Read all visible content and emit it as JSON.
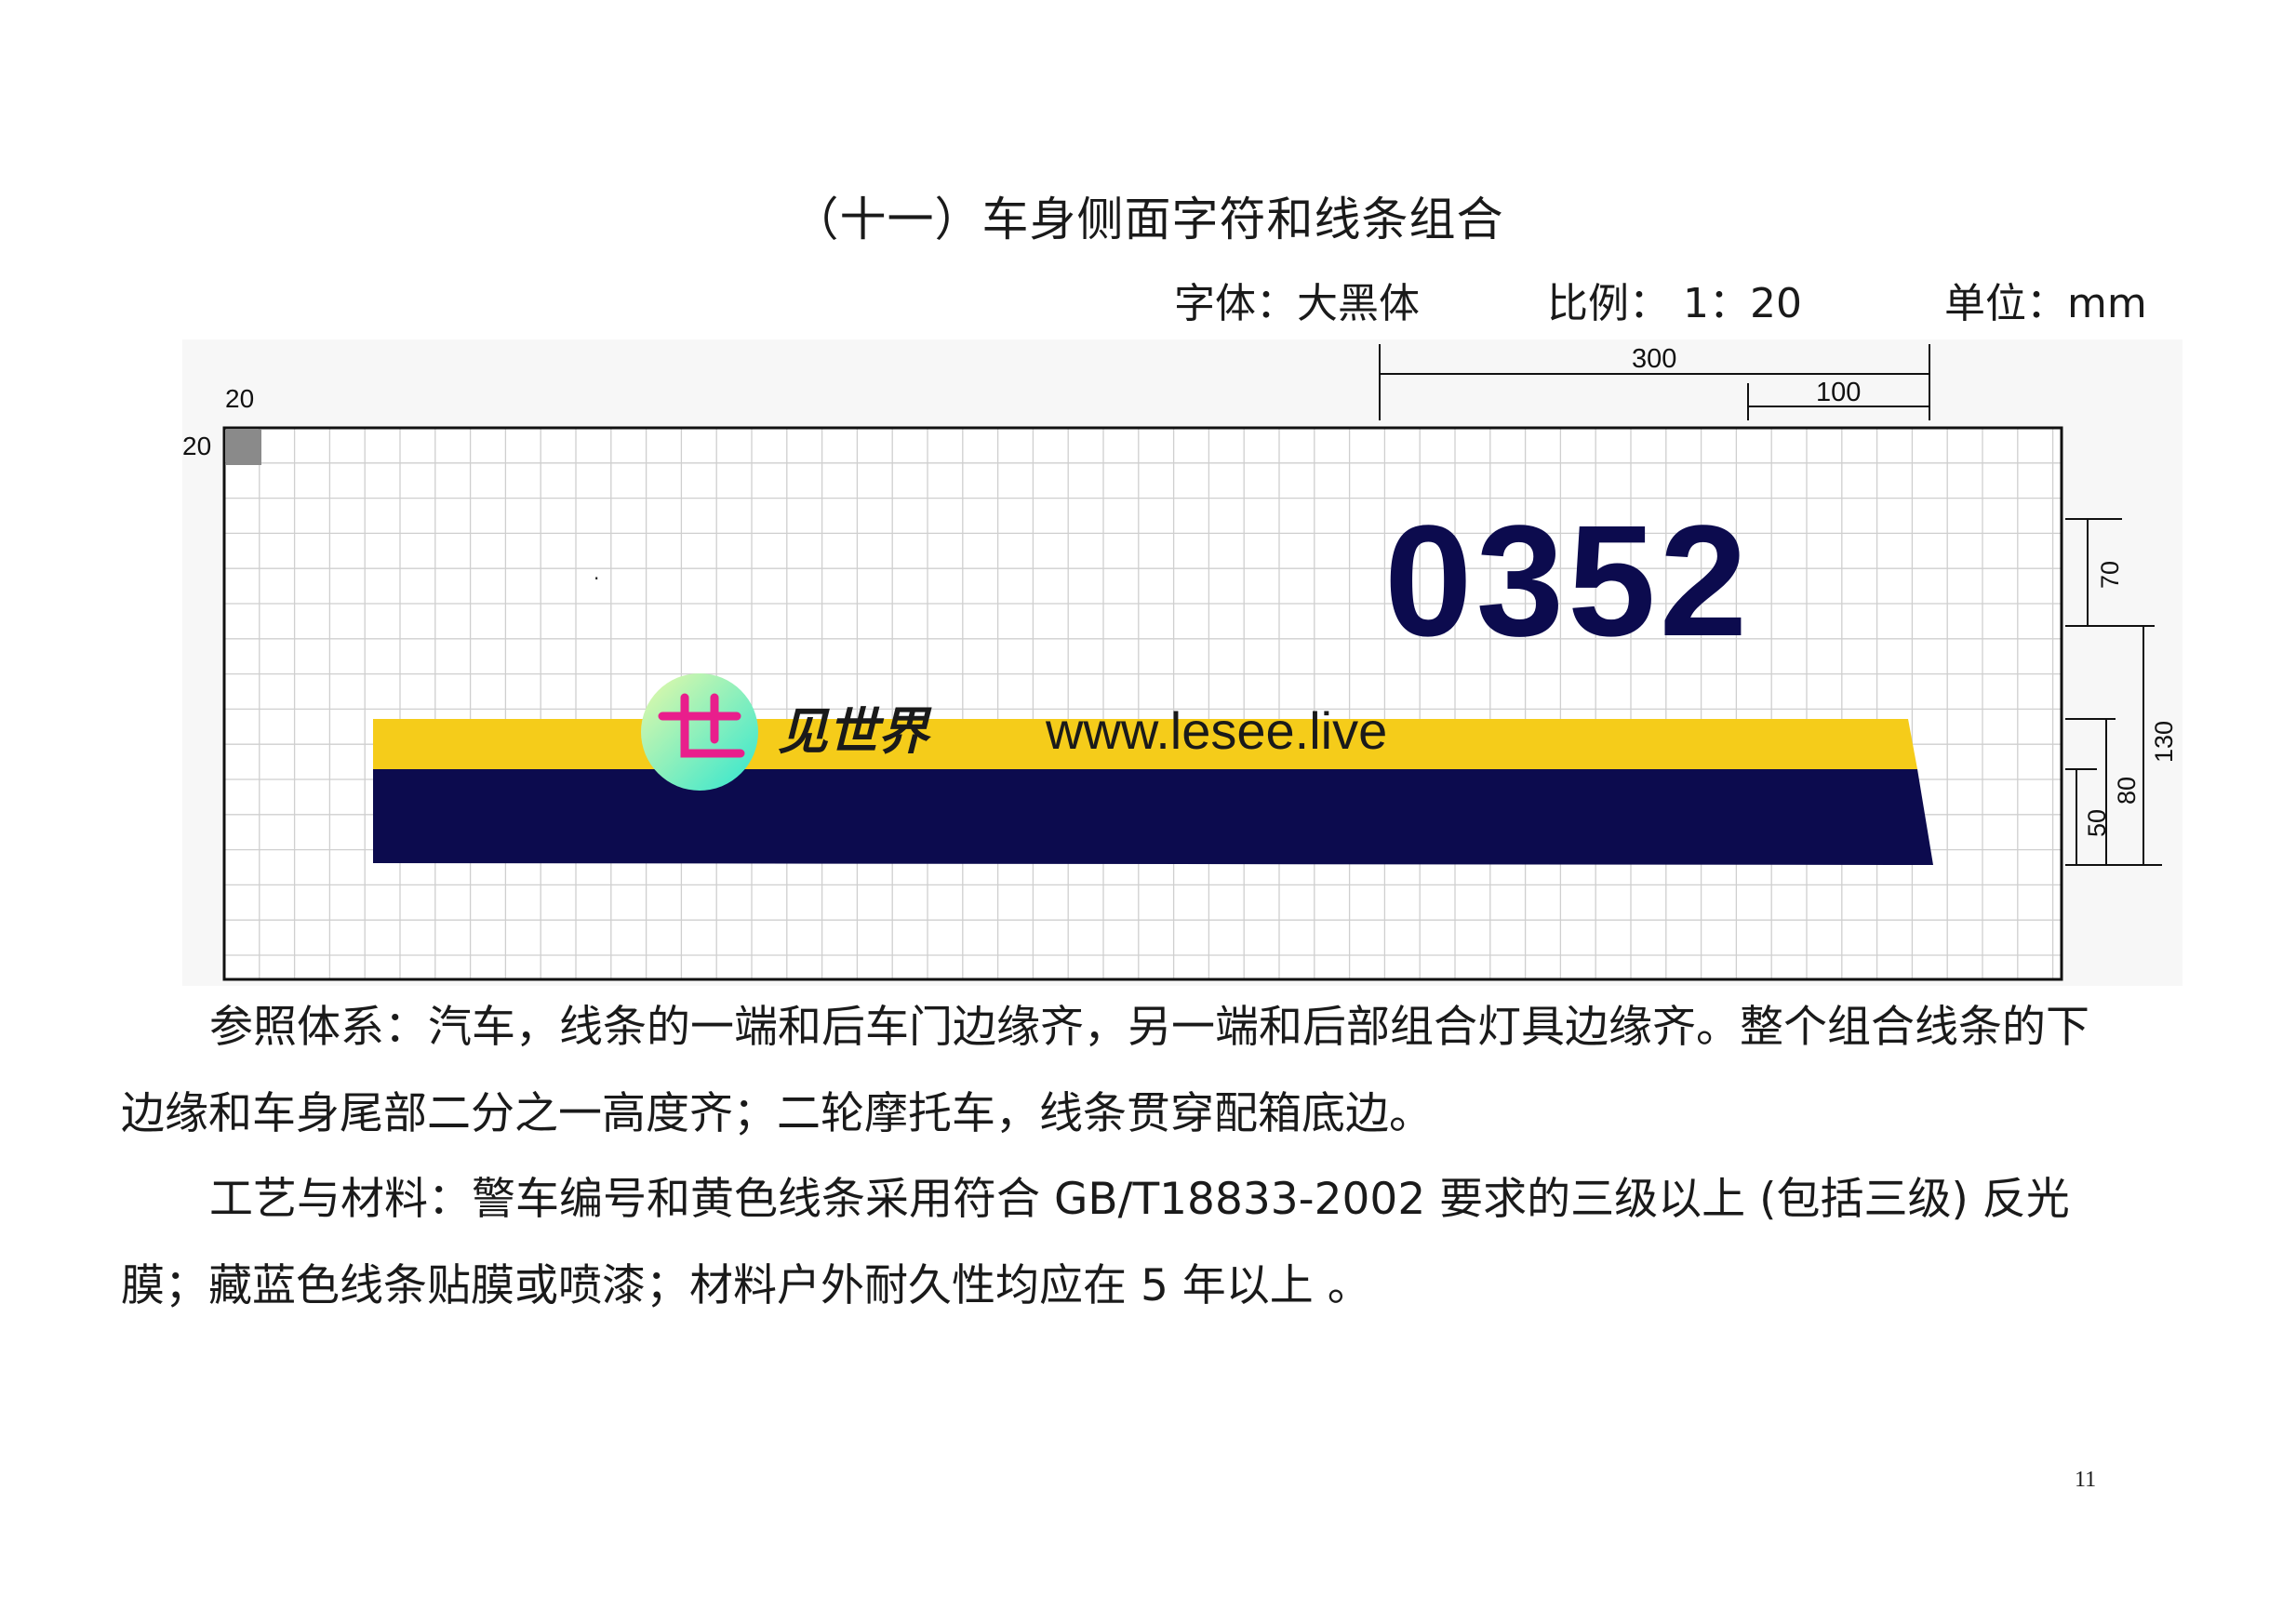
{
  "header": {
    "title": "（十一）车身侧面字符和线条组合",
    "font_spec": "字体：大黑体",
    "scale_spec": "比例：  1：20",
    "unit_spec": "单位：mm"
  },
  "drawing": {
    "car_number": "0352",
    "watermark_text": "www.lesee.live",
    "watermark_brand": "见世界",
    "colors": {
      "yellow_stripe": "#F5CC1A",
      "navy_stripe": "#0C0B4E",
      "number_color": "#0C0B4E",
      "grid_line": "#CFCFCF",
      "corner_square": "#8A8A8A"
    },
    "dimensions": {
      "grid_cell": "20",
      "grid_cell_side": "20",
      "top_total": "300",
      "top_sub": "100",
      "number_height": "70",
      "total_height": "130",
      "stripe_height": "80",
      "navy_height": "50"
    }
  },
  "body": {
    "paragraph1": "参照体系：汽车，线条的一端和后车门边缘齐，另一端和后部组合灯具边缘齐。整个组合线条的下边缘和车身尾部二分之一高度齐；二轮摩托车，线条贯穿配箱底边。",
    "paragraph2": "工艺与材料：警车编号和黄色线条采用符合 GB/T18833-2002 要求的三级以上 (包括三级) 反光膜；藏蓝色线条贴膜或喷漆；材料户外耐久性均应在 5 年以上  。"
  },
  "footer": {
    "page_number": "11"
  }
}
